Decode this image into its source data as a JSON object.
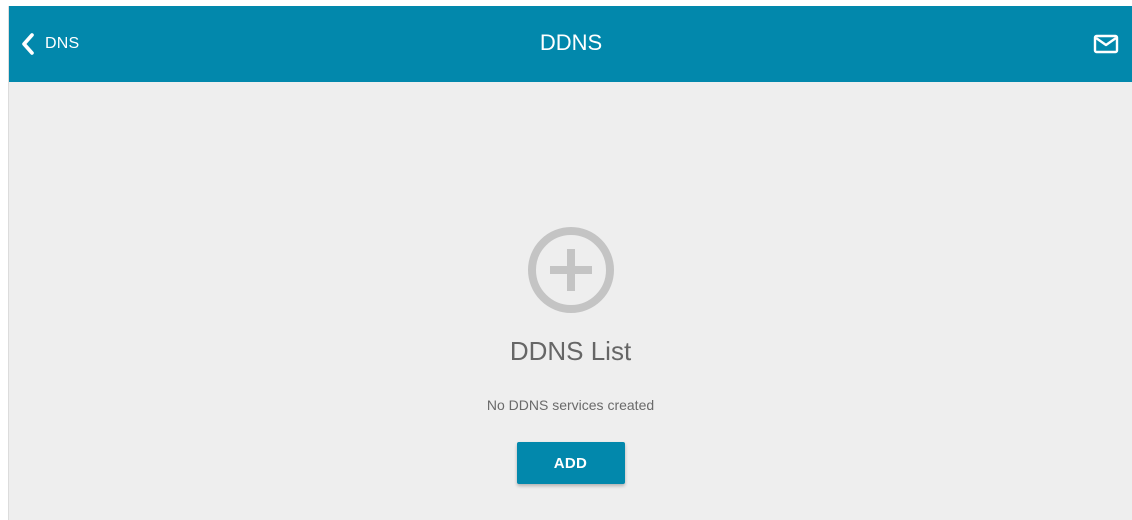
{
  "header": {
    "back_label": "DNS",
    "title": "DDNS",
    "back_icon": "chevron-left-icon",
    "mail_icon": "mail-icon"
  },
  "empty_state": {
    "icon": "add-circle-icon",
    "title": "DDNS List",
    "message": "No DDNS services created",
    "add_label": "ADD"
  },
  "colors": {
    "accent": "#0288ac",
    "background": "#eeeeee",
    "icon_gray": "#c4c4c4",
    "text_gray": "#666666"
  }
}
